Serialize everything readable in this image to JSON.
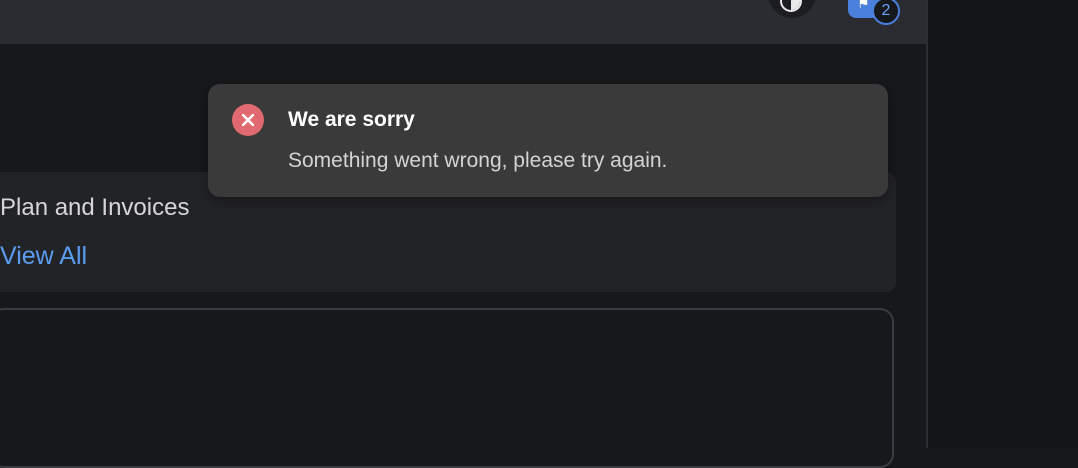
{
  "header": {
    "theme_toggle_icon": "contrast-icon",
    "notifications_icon": "megaphone-icon",
    "notifications_count": "2"
  },
  "plan_card": {
    "title": "Plan and Invoices",
    "link_label": "View All"
  },
  "toast": {
    "icon": "error-icon",
    "title": "We are sorry",
    "message": "Something went wrong, please try again."
  },
  "colors": {
    "background": "#17181b",
    "topbar": "#2b2c31",
    "card": "#222327",
    "toast": "#3a3a3b",
    "error": "#e06a6f",
    "link": "#5b9cf0",
    "accent": "#4a7fdc"
  }
}
